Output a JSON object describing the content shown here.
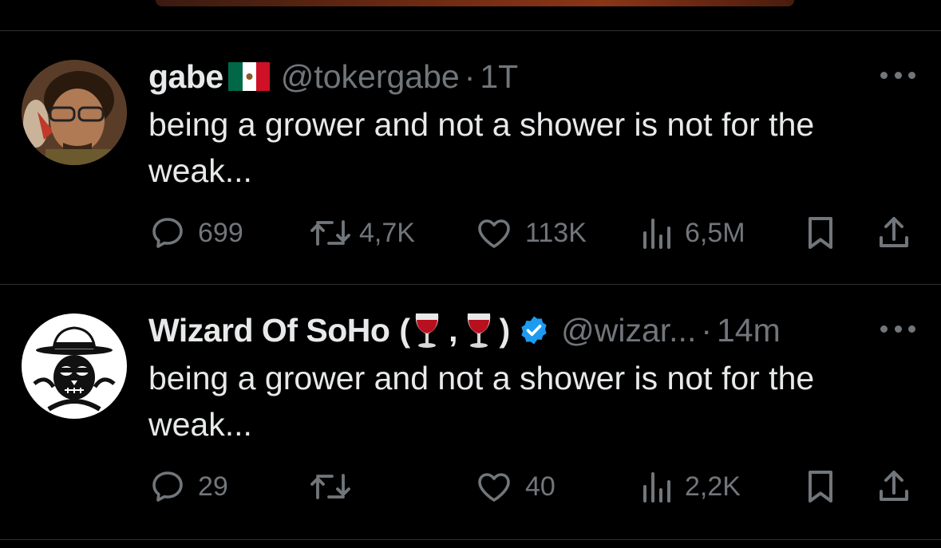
{
  "tweets": [
    {
      "name": "gabe",
      "flag": "mexico-flag",
      "handle": "@tokergabe",
      "separator": "·",
      "time": "1T",
      "text": "being a grower and not a shower is not for the weak...",
      "replies": "699",
      "retweets": "4,7K",
      "likes": "113K",
      "views": "6,5M"
    },
    {
      "name": "Wizard Of SoHo",
      "name_open": "(",
      "name_comma": ",",
      "name_close": ")",
      "verified": true,
      "handle": "@wizar...",
      "separator": "·",
      "time": "14m",
      "text": "being a grower and not a shower is not for the weak...",
      "replies": "29",
      "retweets": "",
      "likes": "40",
      "views": "2,2K"
    }
  ],
  "colors": {
    "background": "#000000",
    "text": "#e7e9ea",
    "muted": "#71767b",
    "divider": "#2f3336",
    "verified": "#1d9bf0"
  },
  "icons": [
    "reply-icon",
    "retweet-icon",
    "like-icon",
    "views-icon",
    "bookmark-icon",
    "share-icon",
    "more-icon",
    "wine-glass-icon",
    "verified-badge-icon",
    "mexico-flag"
  ]
}
